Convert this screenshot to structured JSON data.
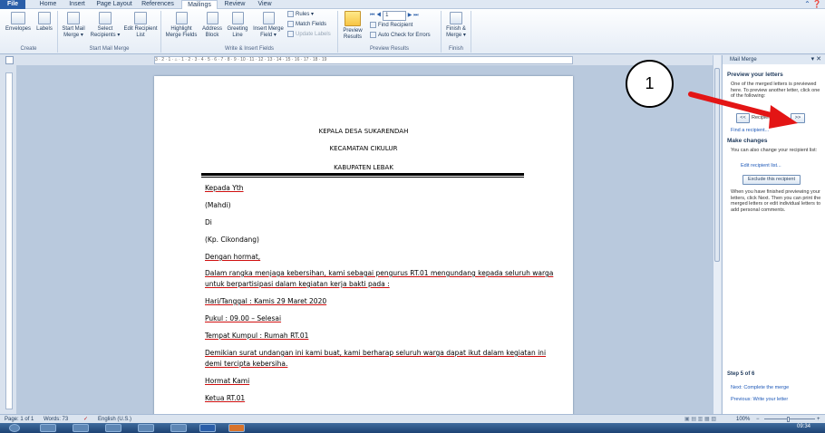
{
  "tabs": [
    "File",
    "Home",
    "Insert",
    "Page Layout",
    "References",
    "Mailings",
    "Review",
    "View"
  ],
  "ribbon": {
    "envelopes": "Envelopes",
    "labels": "Labels",
    "start_mail_merge": "Start Mail Merge ▾",
    "select_recipients": "Select Recipients ▾",
    "edit_recipient_list": "Edit Recipient List",
    "highlight_merge_fields": "Highlight Merge Fields",
    "address_block": "Address Block",
    "greeting_line": "Greeting Line",
    "insert_merge_field": "Insert Merge Field ▾",
    "rules": "Rules ▾",
    "match_fields": "Match Fields",
    "update_labels": "Update Labels",
    "preview_results": "Preview Results",
    "record_number": "1",
    "find_recipient": "Find Recipient",
    "auto_check": "Auto Check for Errors",
    "finish_merge": "Finish & Merge ▾",
    "groups": {
      "create": "Create",
      "start": "Start Mail Merge",
      "write": "Write & Insert Fields",
      "preview": "Preview Results",
      "finish": "Finish"
    }
  },
  "ruler_text": "3 · 2 · 1 · ⌂ · 1 · 2 · 3 · 4 · 5 · 6 · 7 · 8 · 9 · 10 · 11 · 12 · 13 · 14 · 15 · 16 · 17 · 18 · 19",
  "document": {
    "h1": "KEPALA DESA SUKARENDAH",
    "h2": "KECAMATAN CIKULUR",
    "h3": "KABUPATEN LEBAK",
    "l1": "Kepada Yth",
    "l2": "(Mahdi)",
    "l3": "Di",
    "l4": "(Kp. Cikondang)",
    "l5": "Dengan hormat,",
    "l6": "Dalam rangka menjaga kebersihan, kami sebagai pengurus RT.01 mengundang kepada seluruh warga",
    "l7": "untuk berpartisipasi dalam kegiatan kerja bakti pada :",
    "l8": "Hari/Tanggal : Kamis 29 Maret 2020",
    "l9": "Pukul : 09.00 – Selesai",
    "l10": "Tempat Kumpul : Rumah RT.01",
    "l11": "Demikian surat undangan ini kami buat, kami berharap seluruh warga dapat ikut dalam kegiatan ini",
    "l12": "demi tercipta kebersiha.",
    "l13": "Hormat Kami",
    "l14": "Ketua RT.01"
  },
  "pane": {
    "title": "Mail Merge",
    "preview_heading": "Preview your letters",
    "preview_text": "One of the merged letters is previewed here. To preview another letter, click one of the following:",
    "prev": "<<",
    "recipient": "Recipient: 1",
    "next": ">>",
    "find": "Find a recipient...",
    "changes_heading": "Make changes",
    "changes_text": "You can also change your recipient list:",
    "edit_list": "Edit recipient list...",
    "exclude": "Exclude this recipient",
    "finish_text": "When you have finished previewing your letters, click Next. Then you can print the merged letters or edit individual letters to add personal comments.",
    "step": "Step 5 of 6",
    "next_step": "Next: Complete the merge",
    "prev_step": "Previous: Write your letter"
  },
  "status": {
    "page": "Page: 1 of 1",
    "words": "Words: 73",
    "language": "English (U.S.)",
    "zoom": "100%",
    "zoom_minus": "−",
    "zoom_plus": "+"
  },
  "taskbar": {
    "time": "09:34"
  },
  "annotation": {
    "number": "1"
  }
}
